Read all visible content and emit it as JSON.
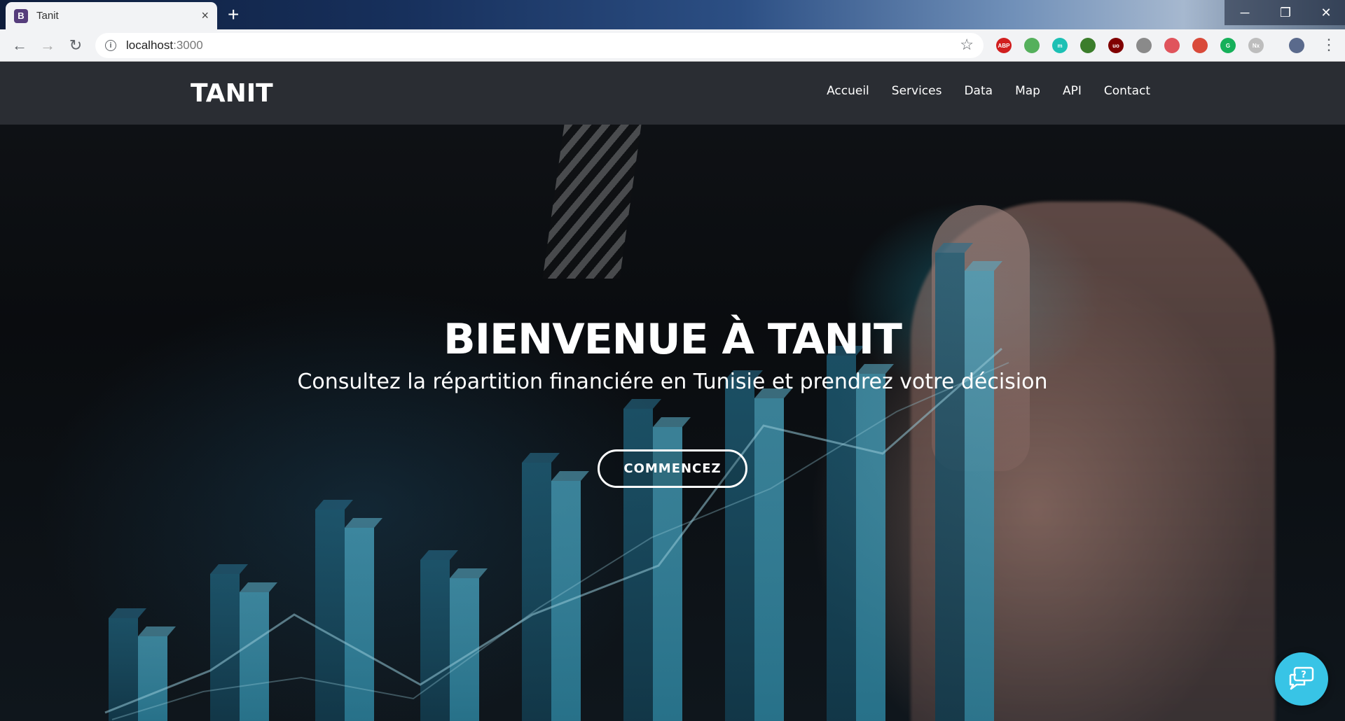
{
  "browser": {
    "tab": {
      "favicon": "B",
      "title": "Tanit",
      "close_icon": "×"
    },
    "new_tab": "+",
    "window_controls": {
      "minimize": "─",
      "maximize": "❐",
      "close": "✕"
    },
    "nav": {
      "back": "←",
      "forward": "→",
      "reload": "↻"
    },
    "address": {
      "host": "localhost",
      "port": ":3000"
    },
    "bookmark_icon": "☆",
    "extensions": [
      {
        "name": "adblock-plus-icon",
        "label": "ABP",
        "color": "#d11f1f"
      },
      {
        "name": "mail-extension-icon",
        "label": "",
        "color": "#55b05c"
      },
      {
        "name": "m-extension-icon",
        "label": "m",
        "color": "#1cc0b4"
      },
      {
        "name": "globe-extension-icon",
        "label": "",
        "color": "#3b7d2b"
      },
      {
        "name": "ublock-origin-icon",
        "label": "uo",
        "color": "#800000"
      },
      {
        "name": "eye-extension-icon",
        "label": "",
        "color": "#8a8a8a"
      },
      {
        "name": "shield-extension-icon",
        "label": "",
        "color": "#e0545c"
      },
      {
        "name": "colorful-extension-icon",
        "label": "",
        "color": "#d94a3a"
      },
      {
        "name": "grammarly-icon",
        "label": "G",
        "color": "#16b05a"
      },
      {
        "name": "nx-extension-icon",
        "label": "Nx",
        "color": "#bdbdbd"
      },
      {
        "name": "profile-avatar-icon",
        "label": "",
        "color": "#5a6a8c"
      }
    ],
    "menu_icon": "⋮"
  },
  "site": {
    "logo": "TANIT",
    "nav": [
      "Accueil",
      "Services",
      "Data",
      "Map",
      "API",
      "Contact"
    ],
    "hero": {
      "title": "BIENVENUE À TANIT",
      "subtitle": "Consultez la répartition financiére en Tunisie et prendrez votre décision",
      "cta": "COMMENCEZ"
    },
    "chat_icon": "help-chat-icon"
  },
  "colors": {
    "navbar": "#2d3036",
    "accent": "#38c4e6",
    "bar": "#3b8ea8"
  }
}
